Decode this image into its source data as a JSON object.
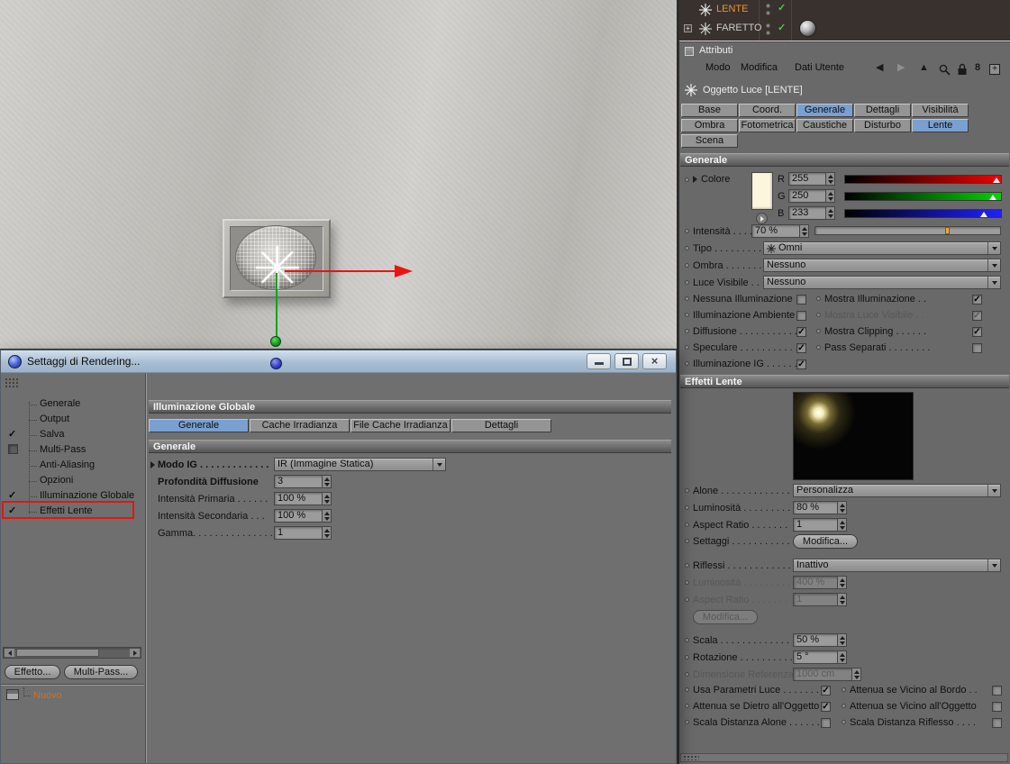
{
  "colors": {
    "accent_tab_blue": "#79a0d0",
    "selected_object_orange": "#e8952f",
    "annotation_red": "#e31515",
    "color_swatch": "#fcf6df"
  },
  "om": {
    "items": [
      {
        "name": "LENTE",
        "check": "✓"
      },
      {
        "name": "FARETTO",
        "check": "✓"
      }
    ]
  },
  "attr": {
    "panel_title": "Attributi",
    "menu": [
      "Modo",
      "Modifica",
      "Dati Utente"
    ],
    "icons": {
      "back": "◀",
      "forward": "▶",
      "up": "▲",
      "link": "8",
      "add": "+"
    },
    "object_title": "Oggetto Luce [LENTE]",
    "tabs1": [
      "Base",
      "Coord.",
      "Generale",
      "Dettagli",
      "Visibilità"
    ],
    "tabs2": [
      "Ombra",
      "Fotometrica",
      "Caustiche",
      "Disturbo",
      "Lente"
    ],
    "tabs3": [
      "Scena"
    ],
    "gen": {
      "header": "Generale",
      "colore_label": "Colore",
      "rgb": [
        {
          "ch": "R",
          "val": "255"
        },
        {
          "ch": "G",
          "val": "250"
        },
        {
          "ch": "B",
          "val": "233"
        }
      ],
      "intensita_label": "Intensità . . . . . .",
      "intensita_val": "70 %",
      "tipo_label": "Tipo . . . . . . . . . .",
      "tipo_val": "Omni",
      "ombra_label": "Ombra . . . . . . .",
      "ombra_val": "Nessuno",
      "luce_label": "Luce Visibile . . .",
      "luce_val": "Nessuno",
      "cks": [
        {
          "l": "Nessuna Illuminazione",
          "lm": "",
          "r": "Mostra Illuminazione . .",
          "rm": "✓"
        },
        {
          "l": "Illuminazione Ambiente",
          "lm": "",
          "r": "Mostra Luce Visibile . .",
          "rm": "✓"
        },
        {
          "l": "Diffusione . . . . . . . . . . .",
          "lm": "✓",
          "r": "Mostra Clipping . . . . . .",
          "rm": "✓"
        },
        {
          "l": "Speculare . . . . . . . . . . .",
          "lm": "✓",
          "r": "Pass Separati . . . . . . . .",
          "rm": ""
        },
        {
          "l": "Illuminazione IG . . . . . .",
          "lm": "✓"
        }
      ]
    },
    "fx": {
      "header": "Effetti Lente",
      "alone_label": "Alone . . . . . . . . . . . . .",
      "alone_val": "Personalizza",
      "lum_label": "Luminosità . . . . . . . . .",
      "lum_val": "80 %",
      "ar_label": "Aspect Ratio . . . . . . .",
      "ar_val": "1",
      "set_label": "Settaggi . . . . . . . . . . .",
      "set_btn": "Modifica...",
      "rif_label": "Riflessi . . . . . . . . . . . .",
      "rif_val": "Inattivo",
      "lum2_label": "Luminosità . . . . . . . . .",
      "lum2_val": "400 %",
      "ar2_label": "Aspect Ratio . . . . . . .",
      "ar2_val": "1",
      "mod2_btn": "Modifica...",
      "scala_label": "Scala . . . . . . . . . . . . . .",
      "scala_val": "50 %",
      "rot_label": "Rotazione . . . . . . . . . .",
      "rot_val": "5 °",
      "dim_label": "Dimensione Referenza",
      "dim_val": "1000 cm",
      "cks": [
        {
          "l": "Usa Parametri Luce . . . . . . .",
          "lm": "✓",
          "r": "Attenua se Vicino al Bordo . .",
          "rm": ""
        },
        {
          "l": "Attenua se Dietro all'Oggetto",
          "lm": "✓",
          "r": "Attenua se Vicino all'Oggetto",
          "rm": ""
        },
        {
          "l": "Scala Distanza Alone . . . . . .",
          "lm": "",
          "r": "Scala Distanza Riflesso . . . .",
          "rm": ""
        }
      ]
    }
  },
  "rs": {
    "title": "Settaggi di Rendering...",
    "list": [
      {
        "label": "Generale"
      },
      {
        "label": "Output"
      },
      {
        "label": "Salva",
        "mark": "✓"
      },
      {
        "label": "Multi-Pass",
        "mark": ""
      },
      {
        "label": "Anti-Aliasing"
      },
      {
        "label": "Opzioni"
      },
      {
        "label": "Illuminazione Globale",
        "mark": "✓"
      },
      {
        "label": "Effetti Lente",
        "mark": "✓"
      }
    ],
    "panel_header": "Illuminazione Globale",
    "tabs": [
      "Generale",
      "Cache Irradianza",
      "File Cache Irradianza",
      "Dettagli"
    ],
    "section": "Generale",
    "modo_label": "Modo IG . . . . . . . . . . . . .",
    "modo_val": "IR (Immagine Statica)",
    "prof_label": "Profondità Diffusione",
    "prof_val": "3",
    "ip_label": "Intensità Primaria . . . . . .",
    "ip_val": "100 %",
    "is_label": "Intensità Secondaria . . .",
    "is_val": "100 %",
    "gamma_label": "Gamma. . . . . . . . . . . . . . .",
    "gamma_val": "1",
    "effetto_btn": "Effetto...",
    "multipass_btn": "Multi-Pass...",
    "nuovo": "Nuovo"
  }
}
